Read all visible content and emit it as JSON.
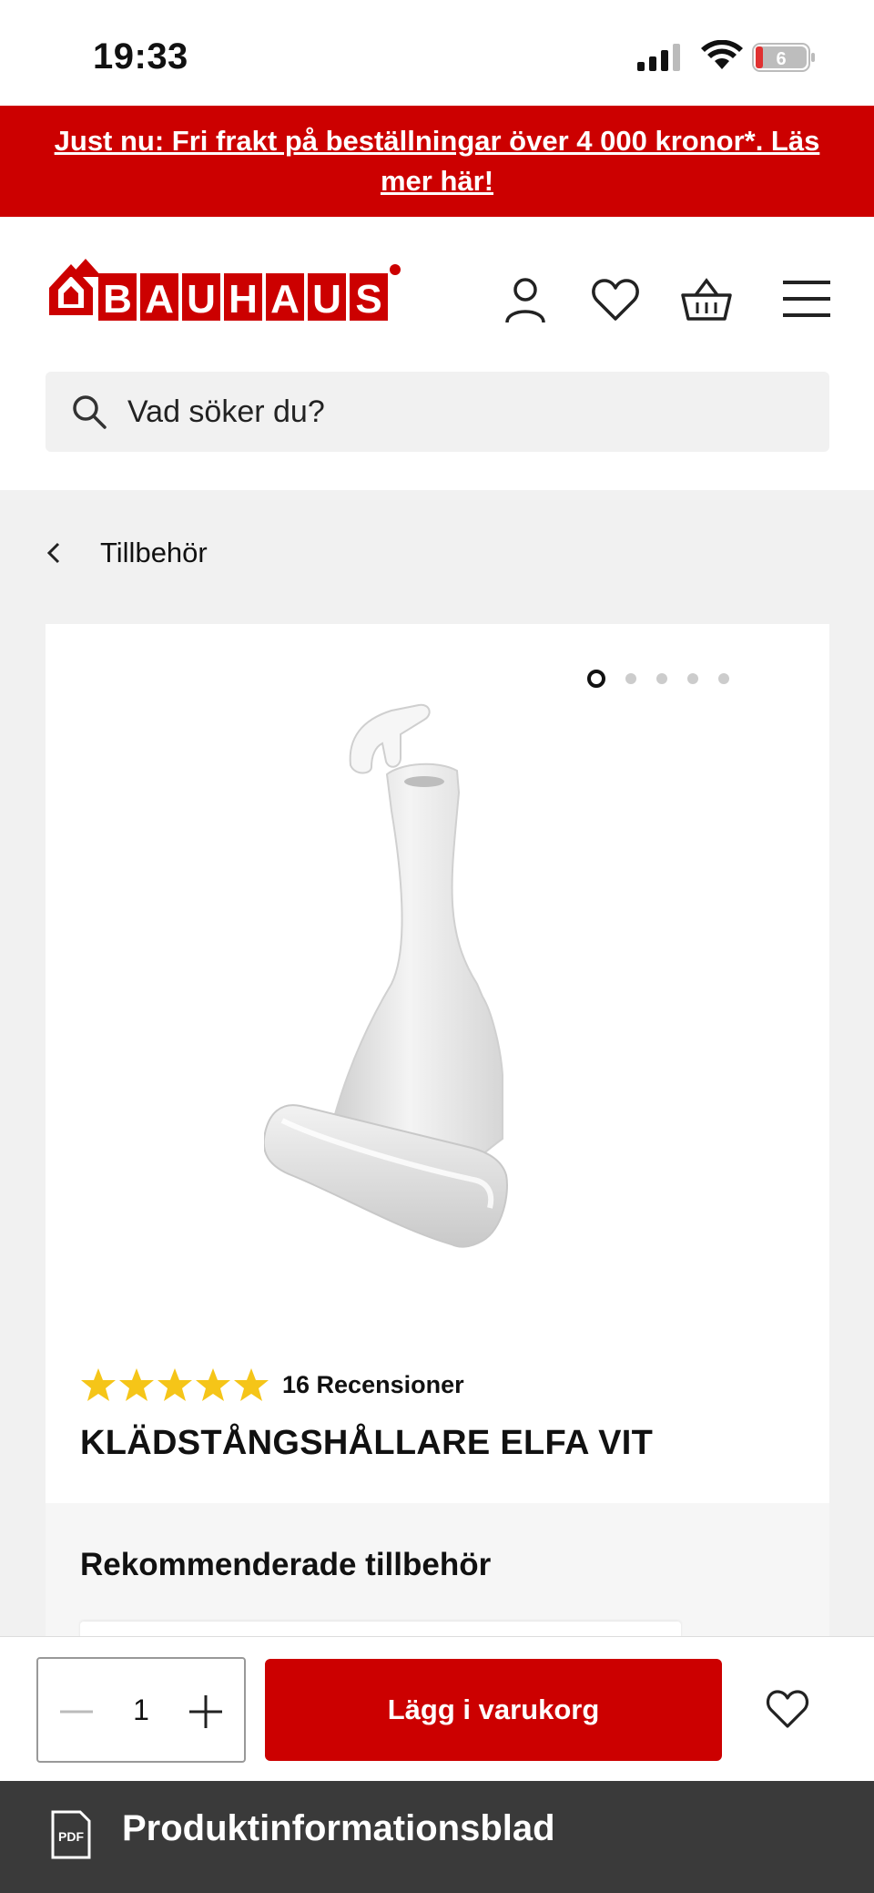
{
  "status_bar": {
    "time": "19:33",
    "battery": "6"
  },
  "promo": {
    "text": "Just nu: Fri frakt på beställningar över 4 000 kronor*. Läs mer här!"
  },
  "header": {
    "logo_text": "BAUHAUS"
  },
  "search": {
    "placeholder": "Vad söker du?"
  },
  "breadcrumb": {
    "label": "Tillbehör"
  },
  "product": {
    "carousel": {
      "total": 5,
      "active": 1
    },
    "rating": {
      "stars": 5,
      "reviews_label": "16 Recensioner"
    },
    "title": "KLÄDSTÅNGSHÅLLARE ELFA VIT"
  },
  "recommended": {
    "heading": "Rekommenderade tillbehör"
  },
  "buy_bar": {
    "quantity": "1",
    "add_to_cart_label": "Lägg i varukorg"
  },
  "pdf": {
    "label": "Produktinformationsblad",
    "icon_text": "PDF"
  },
  "colors": {
    "brand_red": "#cc0000",
    "star": "#f5c518",
    "footer": "#3a3a3a"
  }
}
